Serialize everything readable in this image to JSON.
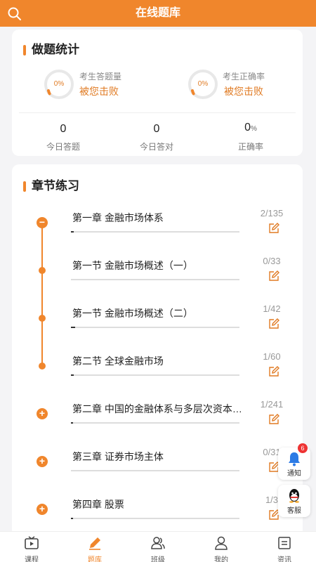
{
  "header": {
    "title": "在线题库"
  },
  "stats": {
    "title": "做题统计",
    "answered": {
      "percent": "0%",
      "label": "考生答题量",
      "sub": "被您击败"
    },
    "accuracy": {
      "percent": "0%",
      "label": "考生正确率",
      "sub": "被您击败"
    },
    "today_answered": {
      "value": "0",
      "label": "今日答题"
    },
    "today_correct": {
      "value": "0",
      "label": "今日答对"
    },
    "correct_rate": {
      "value": "0",
      "unit": "%",
      "label": "正确率"
    }
  },
  "chapters": {
    "title": "章节练习",
    "items": [
      {
        "title": "第一章 金融市场体系",
        "count": "2/135",
        "progress": 0.015,
        "node": "minus"
      },
      {
        "title": "第一节 金融市场概述（一）",
        "count": "0/33",
        "progress": 0,
        "node": "dot"
      },
      {
        "title": "第一节 金融市场概述（二）",
        "count": "1/42",
        "progress": 0.024,
        "node": "dot"
      },
      {
        "title": "第二节 全球金融市场",
        "count": "1/60",
        "progress": 0.017,
        "node": "dot"
      },
      {
        "title": "第二章 中国的金融体系与多层次资本市场",
        "count": "1/241",
        "progress": 0.004,
        "node": "plus"
      },
      {
        "title": "第三章 证券市场主体",
        "count": "0/31",
        "progress": 0,
        "node": "plus"
      },
      {
        "title": "第四章 股票",
        "count": "1/3",
        "progress": 0.01,
        "node": "plus"
      }
    ]
  },
  "floating": {
    "notify": {
      "label": "通知",
      "badge": "6"
    },
    "service": {
      "label": "客服"
    }
  },
  "tabs": [
    {
      "label": "课程",
      "icon": "video-icon"
    },
    {
      "label": "题库",
      "icon": "pencil-icon"
    },
    {
      "label": "班级",
      "icon": "group-icon"
    },
    {
      "label": "我的",
      "icon": "user-icon"
    },
    {
      "label": "资讯",
      "icon": "news-icon"
    }
  ],
  "colors": {
    "accent": "#f0862c",
    "badge": "#e33333"
  }
}
